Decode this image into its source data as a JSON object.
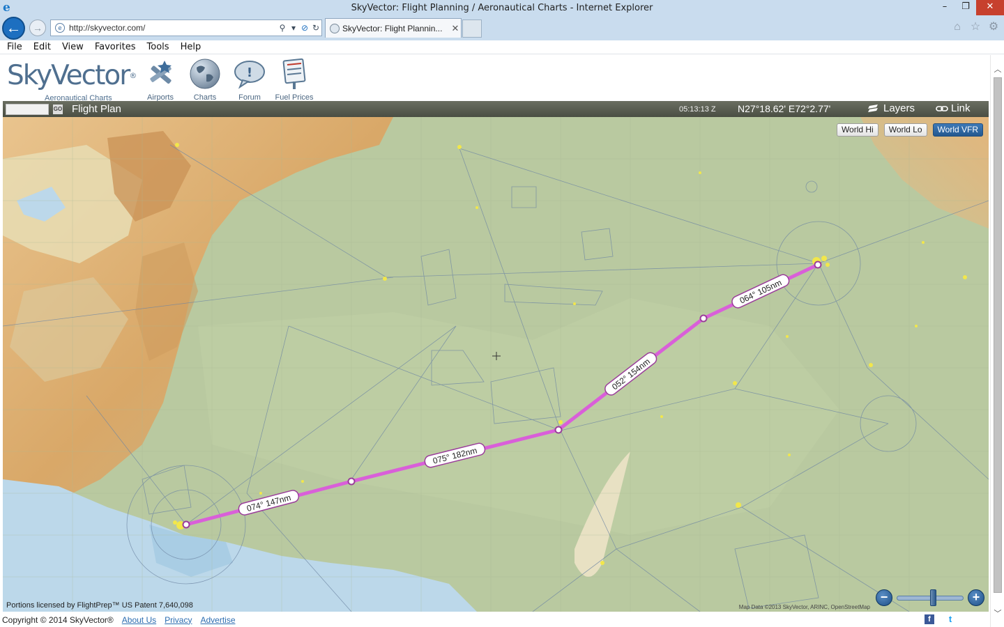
{
  "window": {
    "title": "SkyVector: Flight Planning / Aeronautical Charts - Internet Explorer",
    "min_icon": "minimize-icon",
    "max_icon": "restore-icon",
    "close_icon": "close-icon"
  },
  "browser": {
    "url": "http://skyvector.com/",
    "tab_label": "SkyVector: Flight Plannin...",
    "tab_close": "✕",
    "menu": [
      "File",
      "Edit",
      "View",
      "Favorites",
      "Tools",
      "Help"
    ]
  },
  "site": {
    "brand": "SkyVector",
    "registered": "®",
    "tagline": "Aeronautical Charts",
    "nav": [
      {
        "label": "Airports",
        "icon": "airport-icon"
      },
      {
        "label": "Charts",
        "icon": "globe-icon"
      },
      {
        "label": "Forum",
        "icon": "speech-bubble-icon"
      },
      {
        "label": "Fuel Prices",
        "icon": "fuel-sign-icon"
      }
    ]
  },
  "flightbar": {
    "go_label": "GO",
    "title": "Flight Plan",
    "time": "05:13:13 Z",
    "coords": "N27°18.62' E72°2.77'",
    "layers": "Layers",
    "link": "Link"
  },
  "map": {
    "chart_buttons": [
      "World Hi",
      "World Lo",
      "World VFR"
    ],
    "active_chart": "World VFR",
    "route_color": "#d95fd9",
    "legs": [
      {
        "label": "074° 147nm"
      },
      {
        "label": "075° 182nm"
      },
      {
        "label": "052° 154nm"
      },
      {
        "label": "064° 105nm"
      }
    ],
    "license": "Portions licensed by FlightPrep™ US Patent 7,640,098",
    "map_data": "Map Data ©2013 SkyVector, ARINC, OpenStreetMap",
    "zoom_minus": "−",
    "zoom_plus": "+"
  },
  "footer": {
    "copyright": "Copyright © 2014 SkyVector®",
    "links": [
      "About Us",
      "Privacy",
      "Advertise"
    ]
  }
}
